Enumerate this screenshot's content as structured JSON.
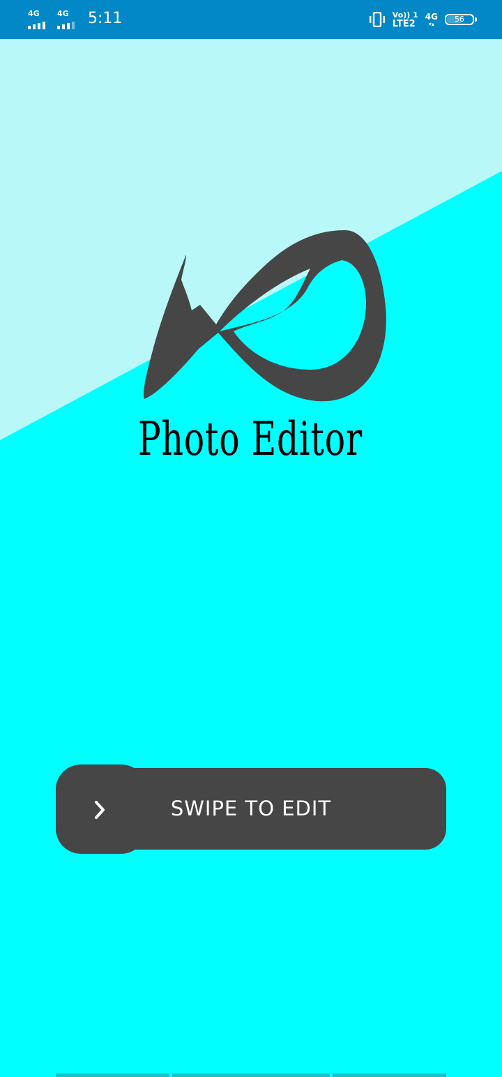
{
  "status_bar": {
    "time": "5:11",
    "sim1_network": "4G",
    "sim2_network": "4G",
    "volte_top": "Vo)) 1",
    "volte_bottom": "LTE2",
    "data_network": "4G",
    "data_arrows": "▾▴",
    "battery_level": "56",
    "background_color": "#0288c7"
  },
  "background": {
    "top_color": "#b8f8f8",
    "bottom_color": "#00ffff"
  },
  "logo": {
    "icon": "photo-editor-logo-icon",
    "text": "Photo Editor",
    "color": "#464646"
  },
  "swipe": {
    "label": "SWIPE TO EDIT",
    "handle_icon": "chevron-right-icon",
    "background_color": "#464646",
    "text_color": "#ffffff"
  }
}
